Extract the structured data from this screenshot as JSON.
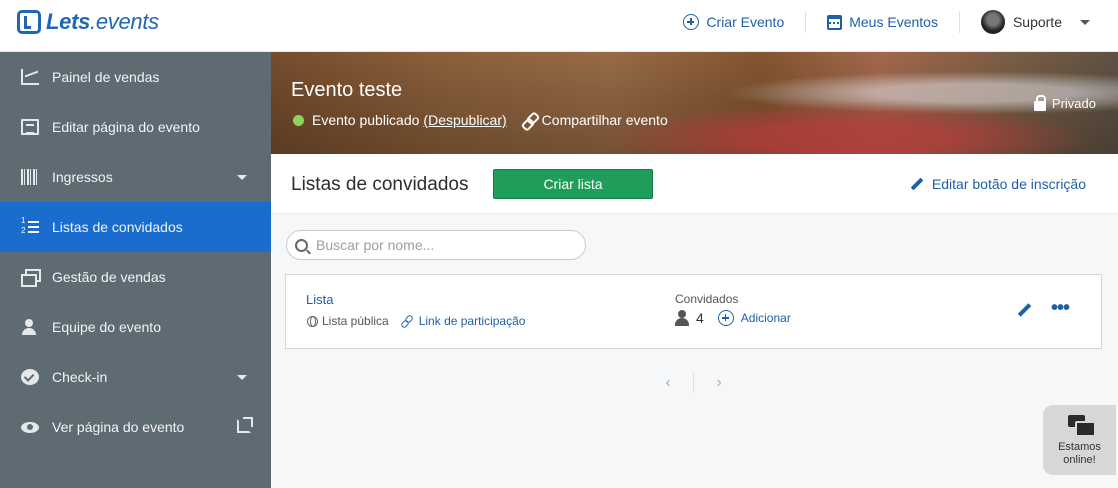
{
  "app": {
    "logo_brand": "Lets",
    "logo_suffix": ".events"
  },
  "topnav": {
    "create_event": "Criar Evento",
    "my_events": "Meus Eventos",
    "user_name": "Suporte"
  },
  "sidebar": {
    "items": [
      {
        "label": "Painel de vendas",
        "icon": "chart-line-icon"
      },
      {
        "label": "Editar página do evento",
        "icon": "page-icon"
      },
      {
        "label": "Ingressos",
        "icon": "barcode-icon",
        "has_submenu": true
      },
      {
        "label": "Listas de convidados",
        "icon": "numbered-list-icon",
        "active": true
      },
      {
        "label": "Gestão de vendas",
        "icon": "sales-icon"
      },
      {
        "label": "Equipe do evento",
        "icon": "team-icon"
      },
      {
        "label": "Check-in",
        "icon": "check-circle-icon",
        "has_submenu": true
      },
      {
        "label": "Ver página do evento",
        "icon": "eye-icon",
        "external": true
      }
    ],
    "active_color": "#1a6dcc",
    "background": "#5f6b73"
  },
  "event": {
    "title": "Evento teste",
    "status": "Evento publicado",
    "unpublish": "(Despublicar)",
    "share": "Compartilhar evento",
    "privacy": "Privado"
  },
  "section": {
    "title": "Listas de convidados",
    "create_button": "Criar lista",
    "edit_signup": "Editar botão de inscrição"
  },
  "search": {
    "placeholder": "Buscar por nome..."
  },
  "lists": [
    {
      "name": "Lista",
      "visibility": "Lista pública",
      "participation_link": "Link de participação",
      "guests_label": "Convidados",
      "guests_count": "4",
      "add_label": "Adicionar"
    }
  ],
  "pager": {
    "prev": "‹",
    "next": "›"
  },
  "chat": {
    "line1": "Estamos",
    "line2": "online!"
  },
  "colors": {
    "brand_blue": "#1e67b8",
    "link_blue": "#1e5fa8",
    "create_green": "#1f9d5a",
    "status_green": "#8fd35a"
  }
}
